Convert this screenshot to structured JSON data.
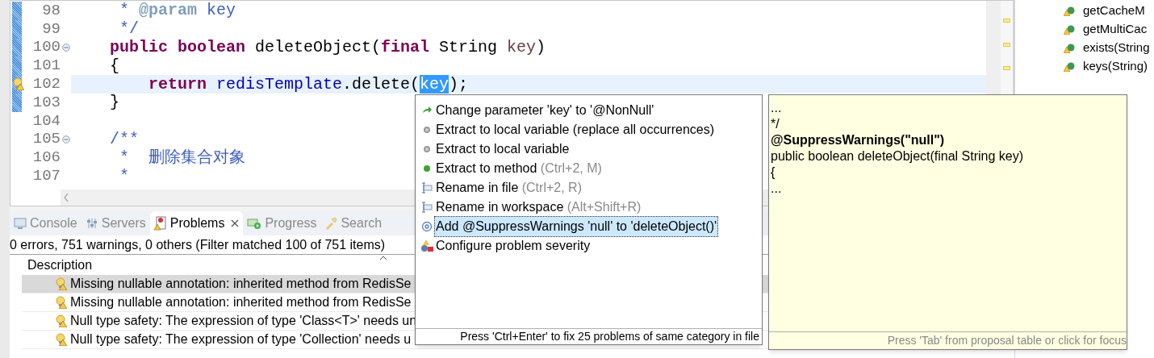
{
  "editor": {
    "lines": [
      {
        "number": "98",
        "kind": "doc",
        "fold": false,
        "changed": true,
        "marker": false,
        "current": false,
        "tokens": [
          {
            "kind": "comment",
            "text": "* "
          },
          {
            "kind": "doctag",
            "text": "@param"
          },
          {
            "kind": "comment",
            "text": " key"
          }
        ]
      },
      {
        "number": "99",
        "kind": "doc",
        "fold": false,
        "changed": true,
        "marker": false,
        "current": false,
        "tokens": [
          {
            "kind": "comment",
            "text": "*/"
          }
        ]
      },
      {
        "number": "100",
        "kind": "member",
        "fold": true,
        "changed": true,
        "marker": false,
        "current": false,
        "tokens": [
          {
            "kind": "keyword",
            "text": "public"
          },
          {
            "kind": "keyword",
            "text": " boolean"
          },
          {
            "kind": "plain",
            "text": " deleteObject("
          },
          {
            "kind": "keyword",
            "text": "final"
          },
          {
            "kind": "plain",
            "text": " String "
          },
          {
            "kind": "param",
            "text": "key"
          },
          {
            "kind": "plain",
            "text": ")"
          }
        ]
      },
      {
        "number": "101",
        "kind": "member",
        "fold": false,
        "changed": true,
        "marker": false,
        "current": false,
        "tokens": [
          {
            "kind": "plain",
            "text": "{"
          }
        ]
      },
      {
        "number": "102",
        "kind": "statement",
        "fold": false,
        "changed": true,
        "marker": true,
        "current": true,
        "tokens": [
          {
            "kind": "keyword",
            "text": "return"
          },
          {
            "kind": "field",
            "text": " redisTemplate"
          },
          {
            "kind": "plain",
            "text": ".delete("
          },
          {
            "kind": "selection",
            "text": "key"
          },
          {
            "kind": "plain",
            "text": ");"
          }
        ]
      },
      {
        "number": "103",
        "kind": "member",
        "fold": false,
        "changed": true,
        "marker": false,
        "current": false,
        "tokens": [
          {
            "kind": "plain",
            "text": "}"
          }
        ]
      },
      {
        "number": "104",
        "fold": false,
        "changed": false,
        "marker": false,
        "current": false
      },
      {
        "number": "105",
        "kind": "member",
        "fold": true,
        "changed": false,
        "marker": false,
        "current": false,
        "tokens": [
          {
            "kind": "comment",
            "text": "/**"
          }
        ]
      },
      {
        "number": "106",
        "kind": "doc",
        "fold": false,
        "changed": false,
        "marker": false,
        "current": false,
        "tokens": [
          {
            "kind": "comment",
            "text": "*  删除集合对象"
          }
        ]
      },
      {
        "number": "107",
        "kind": "doc",
        "fold": false,
        "changed": false,
        "marker": false,
        "current": false,
        "tokens": [
          {
            "kind": "comment",
            "text": "*"
          }
        ]
      }
    ]
  },
  "outline": {
    "items": [
      {
        "label": "getCacheM"
      },
      {
        "label": "getMultiCac"
      },
      {
        "label": "exists(String"
      },
      {
        "label": "keys(String)"
      }
    ]
  },
  "problems_panel": {
    "tabs": [
      {
        "kind": "console",
        "label": "Console",
        "selected": false
      },
      {
        "kind": "servers",
        "label": "Servers",
        "selected": false
      },
      {
        "kind": "problems",
        "label": "Problems",
        "selected": true
      },
      {
        "kind": "progress",
        "label": "Progress",
        "selected": false
      },
      {
        "kind": "search",
        "label": "Search",
        "selected": false
      }
    ],
    "summary": "0 errors, 751 warnings, 0 others (Filter matched 100 of 751 items)",
    "columns": [
      "Description"
    ],
    "rows": [
      {
        "description": "Missing nullable annotation: inherited method from RedisSe",
        "selected": true
      },
      {
        "description": "Missing nullable annotation: inherited method from RedisSe",
        "selected": false
      },
      {
        "description": "Null type safety: The expression of type 'Class<T>' needs un",
        "selected": false
      },
      {
        "description": "Null type safety: The expression of type 'Collection' needs u",
        "selected": false
      }
    ]
  },
  "quick_fix": {
    "items": [
      {
        "kind": "change",
        "label": "Change parameter 'key' to '@NonNull'",
        "selected": false
      },
      {
        "kind": "local",
        "label": "Extract to local variable (replace all occurrences)",
        "selected": false
      },
      {
        "kind": "local",
        "label": "Extract to local variable",
        "selected": false
      },
      {
        "kind": "method",
        "label": "Extract to method",
        "shortcut": "(Ctrl+2, M)",
        "selected": false
      },
      {
        "kind": "rename",
        "label": "Rename in file",
        "shortcut": "(Ctrl+2, R)",
        "selected": false
      },
      {
        "kind": "rename",
        "label": "Rename in workspace",
        "shortcut": "(Alt+Shift+R)",
        "selected": false
      },
      {
        "kind": "annotation",
        "label": "Add @SuppressWarnings 'null' to 'deleteObject()'",
        "selected": true
      },
      {
        "kind": "configure",
        "label": "Configure problem severity",
        "selected": false
      }
    ],
    "footer": "Press 'Ctrl+Enter' to fix 25 problems of same category in file"
  },
  "preview": {
    "lines": [
      {
        "text": "...",
        "bold": false
      },
      {
        "text": "*/",
        "bold": false
      },
      {
        "text": "@SuppressWarnings(\"null\")",
        "bold": true
      },
      {
        "text": "public boolean deleteObject(final String key)",
        "bold": false
      },
      {
        "text": "{",
        "bold": false
      },
      {
        "text": "...",
        "bold": false
      }
    ],
    "footer": "Press 'Tab' from proposal table or click for focus"
  }
}
